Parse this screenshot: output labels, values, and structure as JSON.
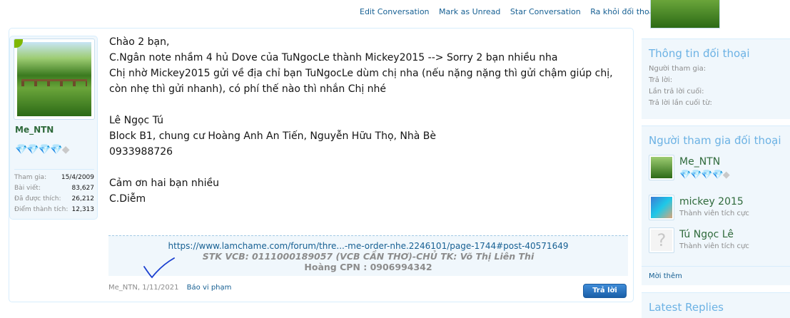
{
  "topbar": {
    "links": [
      "Edit Conversation",
      "Mark as Unread",
      "Star Conversation",
      "Ra khỏi đối thoại này"
    ]
  },
  "post": {
    "author": "Me_NTN",
    "rank_icons": [
      "diamond-icon",
      "diamond-icon",
      "diamond-icon",
      "diamond-icon",
      "diamond-gray-icon"
    ],
    "stats": [
      {
        "label": "Tham gia:",
        "value": "15/4/2009"
      },
      {
        "label": "Bài viết:",
        "value": "83,627"
      },
      {
        "label": "Đã được thích:",
        "value": "26,212"
      },
      {
        "label": "Điểm thành tích:",
        "value": "12,313"
      }
    ],
    "message_lines": [
      "Chào 2 bạn,",
      "C.Ngân note nhầm 4 hủ Dove của TuNgocLe thành Mickey2015 --> Sorry 2 bạn nhiều nha",
      "Chị nhờ Mickey2015 gửi về địa chỉ bạn TuNgocLe dùm chị nha (nếu nặng nặng thì gửi chậm giúp chị,",
      "còn nhẹ thì gửi nhanh), có phí thế nào thì nhắn Chị nhé",
      "",
      "Lê Ngọc Tú",
      "Block B1, chung cư Hoàng Anh An Tiến, Nguyễn Hữu Thọ, Nhà Bè",
      "0933988726",
      "",
      "Cảm ơn hai bạn nhiều",
      "C.Diễm"
    ],
    "signature": {
      "link": "https://www.lamchame.com/forum/thre...-me-order-nhe.2246101/page-1744#post-40571649",
      "line1": "STK VCB: 0111000189057 (VCB CẦN THƠ)-CHỦ TK: Võ Thị Liên Thi",
      "line2": "Hoàng CPN : 0906994342"
    },
    "meta_author_date": "Me_NTN, 1/11/2021",
    "report_label": "Báo vi phạm",
    "reply_label": "Trả lời"
  },
  "sidebar": {
    "info_title": "Thông tin đối thoại",
    "info_labels": [
      "Người tham gia:",
      "Trả lời:",
      "Lần trả lời cuối:",
      "Trả lời lần cuối từ:"
    ],
    "participants_title": "Người tham gia đối thoại",
    "participants": [
      {
        "name": "Me_NTN",
        "title": ""
      },
      {
        "name": "mickey 2015",
        "title": "Thành viên tích cực"
      },
      {
        "name": "Tú Ngọc Lê",
        "title": "Thành viên tích cực"
      }
    ],
    "invite_label": "Mời thêm",
    "latest_title": "Latest Replies"
  },
  "colors": {
    "link": "#176093",
    "username": "#2f6a3b",
    "sidebar_heading": "#6cb2e4",
    "panel_bg": "#f0f7fc",
    "button": "#2a74c2",
    "annotation_ink": "#1a3fd0"
  }
}
